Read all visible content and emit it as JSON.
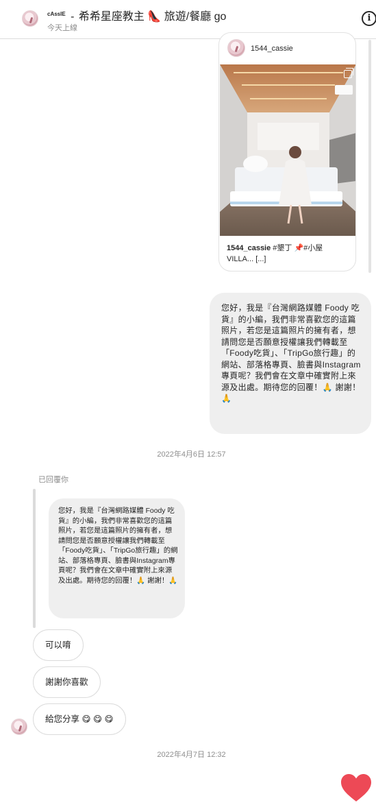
{
  "header": {
    "username": "cAssIE",
    "separator": "-",
    "title": "希希星座教主",
    "heel_emoji": "👠",
    "subtitle": "旅遊/餐廳 go",
    "status": "今天上線",
    "info_icon": "info-icon"
  },
  "shared_post": {
    "username": "1544_cassie",
    "caption_user": "1544_cassie",
    "caption_text": " #墾丁 📌#小屋 VILLA... [...]"
  },
  "outgoing_message": "您好，我是『台灣網路媒體 Foody 吃貨』的小編，我們非常喜歡您的這篇照片，若您是這篇照片的擁有者，想請問您是否願意授權讓我們轉載至「Foody吃貨」、「TripGo旅行趣」的網站、部落格專頁、臉書與Instagram專頁呢？我們會在文章中確實附上來源及出處。期待您的回覆！🙏 謝謝！🙏",
  "timestamp_1": "2022年4月6日 12:57",
  "reply": {
    "label": "已回覆你",
    "quoted_text": "您好，我是『台灣網路媒體 Foody 吃貨』的小編，我們非常喜歡您的這篇照片，若您是這篇照片的擁有者，想請問您是否願意授權讓我們轉載至「Foody吃貨」、「TripGo旅行趣」的網站、部落格專頁、臉書與Instagram專頁呢？我們會在文章中確實附上來源及出處。期待您的回覆！🙏 謝謝！🙏"
  },
  "incoming_messages": [
    {
      "text": "可以唷"
    },
    {
      "text": "謝謝你喜歡"
    },
    {
      "text": "給您分享 😋 😋 😋"
    }
  ],
  "timestamp_2": "2022年4月7日 12:32",
  "like_icon": "heart-icon",
  "colors": {
    "heart": "#ed4956",
    "bubble_gray": "#efefef",
    "muted_text": "#8e8e8e"
  }
}
